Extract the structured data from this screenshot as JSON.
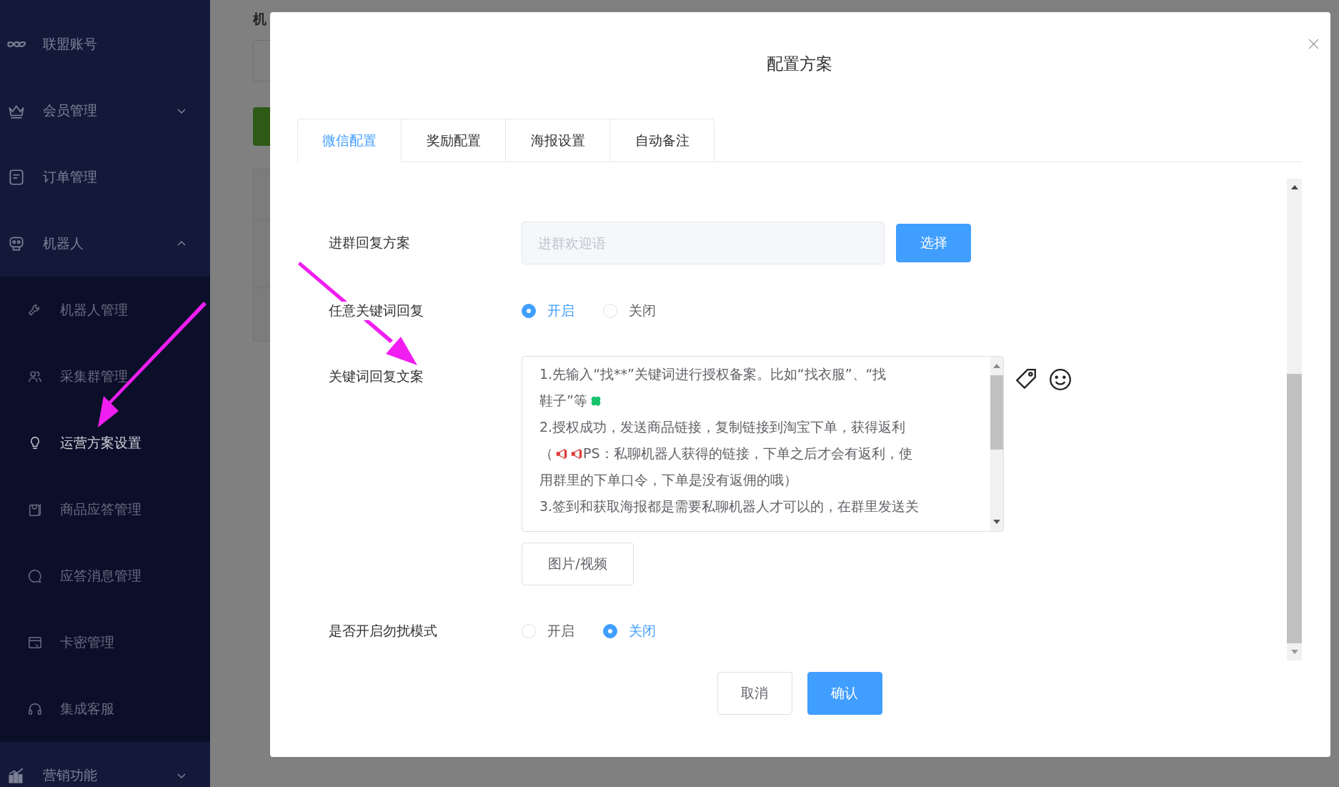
{
  "sidebar": {
    "items": [
      {
        "label": "联盟账号",
        "kind": "link"
      },
      {
        "label": "会员管理",
        "kind": "submenu",
        "expanded": false
      },
      {
        "label": "订单管理",
        "kind": "link"
      },
      {
        "label": "机器人",
        "kind": "submenu",
        "expanded": true,
        "children": [
          {
            "label": "机器人管理",
            "selected": false
          },
          {
            "label": "采集群管理",
            "selected": false
          },
          {
            "label": "运营方案设置",
            "selected": true
          },
          {
            "label": "商品应答管理",
            "selected": false
          },
          {
            "label": "应答消息管理",
            "selected": false
          },
          {
            "label": "卡密管理",
            "selected": false
          },
          {
            "label": "集成客服",
            "selected": false
          }
        ]
      },
      {
        "label": "营销功能",
        "kind": "submenu",
        "expanded": false
      }
    ]
  },
  "page": {
    "title": "机"
  },
  "dialog": {
    "title": "配置方案",
    "tabs": [
      {
        "label": "微信配置",
        "selected": true
      },
      {
        "label": "奖励配置",
        "selected": false
      },
      {
        "label": "海报设置",
        "selected": false
      },
      {
        "label": "自动备注",
        "selected": false
      }
    ],
    "form": [
      {
        "kind": "select",
        "label": "进群回复方案",
        "placeholder": "进群欢迎语",
        "button": "选择"
      },
      {
        "kind": "radio",
        "label": "任意关键词回复",
        "options": [
          {
            "label": "开启",
            "selected": true
          },
          {
            "label": "关闭",
            "selected": false
          }
        ]
      },
      {
        "kind": "text",
        "label": "关键词回复文案",
        "paragraphs": [
          [
            {
              "kind": "text",
              "text": "1.先输入“找**”关键词进行授权备案。比如“找衣服”、“找"
            }
          ],
          [
            {
              "kind": "text",
              "text": "鞋子”等"
            },
            {
              "kind": "clover"
            }
          ],
          [
            {
              "kind": "text",
              "text": "2.授权成功，发送商品链接，复制链接到淘宝下单，获得返利"
            }
          ],
          [
            {
              "kind": "text",
              "text": "（"
            },
            {
              "kind": "megaphone"
            },
            {
              "kind": "megaphone"
            },
            {
              "kind": "text",
              "text": "PS：私聊机器人获得的链接，下单之后才会有返利，使"
            }
          ],
          [
            {
              "kind": "text",
              "text": "用群里的下单口令，下单是没有返佣的哦）"
            }
          ],
          [
            {
              "kind": "text",
              "text": "3.签到和获取海报都是需要私聊机器人才可以的，在群里发送关"
            }
          ]
        ],
        "button": "图片/视频"
      },
      {
        "kind": "radio",
        "label": "是否开启勿扰模式",
        "options": [
          {
            "label": "开启",
            "selected": false
          },
          {
            "label": "关闭",
            "selected": true
          }
        ]
      }
    ],
    "buttons": [
      {
        "label": "取消",
        "kind": "default"
      },
      {
        "label": "确认",
        "kind": "primary"
      }
    ]
  }
}
